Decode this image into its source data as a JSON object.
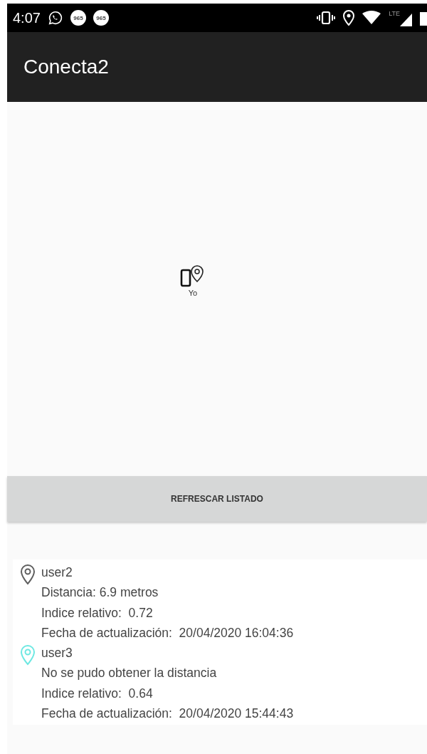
{
  "status_bar": {
    "time": "4:07",
    "badges": [
      "965",
      "965"
    ],
    "network": "LTE"
  },
  "app_bar": {
    "title": "Conecta2"
  },
  "map": {
    "me_label": "Yo"
  },
  "refresh_button": {
    "label": "REFRESCAR LISTADO"
  },
  "users": [
    {
      "name": "user2",
      "color": "#5f5f5f",
      "distance": "Distancia: 6.9 metros",
      "index": "Indice relativo:  0.72",
      "updated": "Fecha de actualización:  20/04/2020 16:04:36"
    },
    {
      "name": "user3",
      "color": "#6ee8e2",
      "distance": "No se pudo obtener la distancia",
      "index": "Indice relativo:  0.64",
      "updated": "Fecha de actualización:  20/04/2020 15:44:43"
    }
  ]
}
